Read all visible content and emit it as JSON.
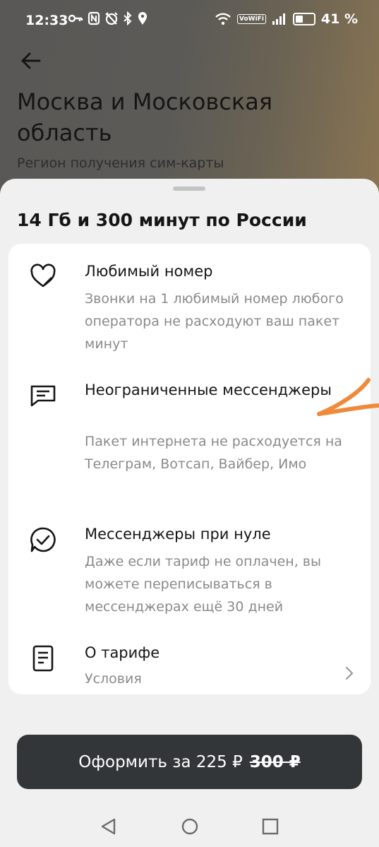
{
  "status_bar": {
    "time": "12:33",
    "network_badge": "VoWiFi",
    "battery": "41 %"
  },
  "header": {
    "title": "Москва и Московская область",
    "subtitle": "Регион получения сим-карты"
  },
  "sheet": {
    "title": "14 Гб и 300 минут по России",
    "features": [
      {
        "icon": "heart-icon",
        "title": "Любимый номер",
        "description": "Звонки на 1 любимый номер любого оператора не расходуют ваш пакет минут"
      },
      {
        "icon": "chat-icon",
        "title": "Неограниченные мессенджеры",
        "description": "Пакет интернета не расходуется на Телеграм, Вотсап, Вайбер, Имо"
      },
      {
        "icon": "chat-check-icon",
        "title": "Мессенджеры при нуле",
        "description": "Даже если тариф не оплачен, вы можете переписываться в мессенджерах ещё 30 дней"
      },
      {
        "icon": "document-icon",
        "title": "О тарифе",
        "description": "Условия"
      }
    ]
  },
  "cta": {
    "label": "Оформить за 225 ₽",
    "old_price": "300 ₽"
  },
  "colors": {
    "annotation": "#f08a3a",
    "button": "#333638"
  }
}
